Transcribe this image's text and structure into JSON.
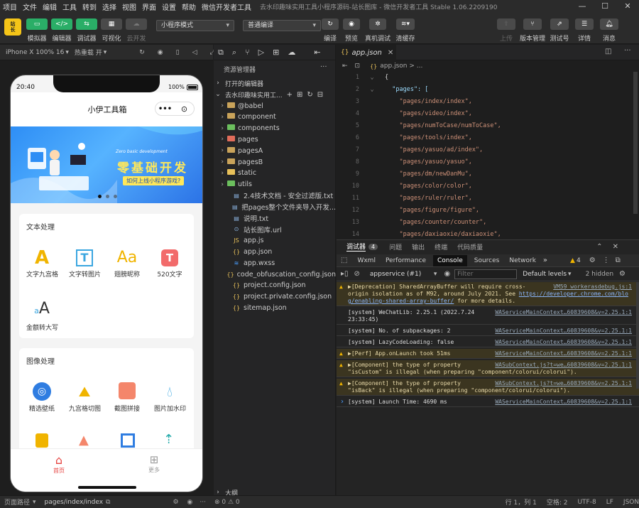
{
  "menubar": {
    "items": [
      "项目",
      "文件",
      "编辑",
      "工具",
      "转到",
      "选择",
      "视图",
      "界面",
      "设置",
      "帮助",
      "微信开发者工具"
    ],
    "title": "去水印趣味实用工具小程序源码-站长图库 - 微信开发者工具 Stable 1.06.2209190"
  },
  "toolbar": {
    "left_buttons": [
      "模拟器",
      "编辑器",
      "调试器",
      "可视化",
      "云开发"
    ],
    "mode_select": "小程序模式",
    "compile_select": "普通编译",
    "mid_buttons": [
      "编译",
      "预览",
      "真机调试",
      "清缓存"
    ],
    "right_buttons": [
      "上传",
      "版本管理",
      "测试号",
      "详情",
      "消息"
    ]
  },
  "simbar": {
    "device": "iPhone X 100% 16",
    "hotreload": "热重载 开"
  },
  "phone": {
    "time": "20:40",
    "battery": "100%",
    "nav_title": "小伊工具箱",
    "banner_small": "Zero basic development",
    "banner_title": "零基础开发",
    "banner_sub": "如何上线小程序游戏?",
    "section1": {
      "title": "文本处理",
      "items": [
        {
          "label": "文字九宫格",
          "icon": "letter-a-icon"
        },
        {
          "label": "文字转图片",
          "icon": "text-image-icon"
        },
        {
          "label": "翅膀昵称",
          "icon": "font-aa-icon"
        },
        {
          "label": "520文字",
          "icon": "t-box-icon"
        },
        {
          "label": "金额转大写",
          "icon": "translate-icon"
        }
      ]
    },
    "section2": {
      "title": "图像处理",
      "items": [
        {
          "label": "精选壁纸",
          "icon": "wallpaper-icon"
        },
        {
          "label": "九宫格切图",
          "icon": "grid-cut-icon"
        },
        {
          "label": "截图拼接",
          "icon": "stitch-icon"
        },
        {
          "label": "图片加水印",
          "icon": "watermark-icon"
        }
      ]
    },
    "tabbar": [
      {
        "label": "首页",
        "active": true
      },
      {
        "label": "更多",
        "active": false
      }
    ]
  },
  "explorer": {
    "header": "资源管理器",
    "open_editors": "打开的编辑器",
    "project": "去水印趣味实用工...",
    "items": [
      {
        "name": "@babel",
        "type": "folder"
      },
      {
        "name": "component",
        "type": "folder"
      },
      {
        "name": "components",
        "type": "folder-green"
      },
      {
        "name": "pages",
        "type": "folder-red"
      },
      {
        "name": "pagesA",
        "type": "folder"
      },
      {
        "name": "pagesB",
        "type": "folder"
      },
      {
        "name": "static",
        "type": "folder-yellow"
      },
      {
        "name": "utils",
        "type": "folder-green"
      },
      {
        "name": "2.4技术文档 - 安全过滤版.txt",
        "type": "txt"
      },
      {
        "name": "把pages整个文件夹导入开发...",
        "type": "txt"
      },
      {
        "name": "说明.txt",
        "type": "txt"
      },
      {
        "name": "站长图库.url",
        "type": "url"
      },
      {
        "name": "app.js",
        "type": "js"
      },
      {
        "name": "app.json",
        "type": "json"
      },
      {
        "name": "app.wxss",
        "type": "wxss"
      },
      {
        "name": "code_obfuscation_config.json",
        "type": "json"
      },
      {
        "name": "project.config.json",
        "type": "json"
      },
      {
        "name": "project.private.config.json",
        "type": "json"
      },
      {
        "name": "sitemap.json",
        "type": "json"
      }
    ],
    "outline": "大纲"
  },
  "editor": {
    "tab": "app.json",
    "breadcrumb": "app.json > ...",
    "lines": [
      {
        "n": "1",
        "code": "{"
      },
      {
        "n": "2",
        "code": "  \"pages\": ["
      },
      {
        "n": "3",
        "code": "    \"pages/index/index\","
      },
      {
        "n": "4",
        "code": "    \"pages/video/index\","
      },
      {
        "n": "5",
        "code": "    \"pages/numToCase/numToCase\","
      },
      {
        "n": "6",
        "code": "    \"pages/tools/index\","
      },
      {
        "n": "7",
        "code": "    \"pages/yasuo/ad/index\","
      },
      {
        "n": "8",
        "code": "    \"pages/yasuo/yasuo\","
      },
      {
        "n": "9",
        "code": "    \"pages/dm/newDanMu\","
      },
      {
        "n": "10",
        "code": "    \"pages/color/color\","
      },
      {
        "n": "11",
        "code": "    \"pages/ruler/ruler\","
      },
      {
        "n": "12",
        "code": "    \"pages/figure/figure\","
      },
      {
        "n": "13",
        "code": "    \"pages/counter/counter\","
      },
      {
        "n": "14",
        "code": "    \"pages/daxiaoxie/daxiaoxie\","
      }
    ]
  },
  "console": {
    "top_tabs": [
      "调试器",
      "问题",
      "输出",
      "终端",
      "代码质量"
    ],
    "debug_badge": "4",
    "devtabs": [
      "Wxml",
      "Performance",
      "Console",
      "Sources",
      "Network"
    ],
    "warn_count": "4",
    "context": "appservice (#1)",
    "filter_placeholder": "Filter",
    "levels": "Default levels",
    "hidden": "2 hidden",
    "messages": [
      {
        "type": "warn",
        "text1": "▶[Deprecation] SharedArrayBuffer will require cross-",
        "text2": "origin isolation as of M92, around July 2021. See ",
        "link": "https://developer.chrome.com/blo",
        "text3": "g/enabling-shared-array-buffer/",
        "text4": " for more details.",
        "src": "VM59 workerasdebug.js:1"
      },
      {
        "type": "log",
        "text1": "[system] WeChatLib: 2.25.1 (2022.7.24",
        "text2": "23:33:45)",
        "src": "WAServiceMainContext…60839608&v=2.25.1:1"
      },
      {
        "type": "log",
        "text1": "[system] No. of subpackages: 2",
        "src": "WAServiceMainContext…60839608&v=2.25.1:1"
      },
      {
        "type": "log",
        "text1": "[system] LazyCodeLoading: false",
        "src": "WAServiceMainContext…60839608&v=2.25.1:1"
      },
      {
        "type": "warn",
        "text1": "▶[Perf] App.onLaunch took 51ms",
        "src": "WAServiceMainContext…60839608&v=2.25.1:1"
      },
      {
        "type": "warn",
        "text1": "▶[Component] the type of property",
        "text2": "\"isCustom\" is illegal (when preparing \"component/colorui/colorui\").",
        "src": "WASubContext.js?t=we…60839608&v=2.25.1:1"
      },
      {
        "type": "warn",
        "text1": "▶[Component] the type of property",
        "text2": "\"isBack\" is illegal (when preparing \"component/colorui/colorui\").",
        "src": "WASubContext.js?t=we…60839608&v=2.25.1:1"
      },
      {
        "type": "log",
        "text1": "[system] Launch Time: 4690 ms",
        "src": "WAServiceMainContext…60839608&v=2.25.1:1"
      }
    ]
  },
  "statusbar": {
    "path_label": "页面路径",
    "path": "pages/index/index",
    "errors": "⊗ 0 ⚠ 0",
    "cursor": "行 1，列 1",
    "spaces": "空格: 2",
    "encoding": "UTF-8",
    "eol": "LF",
    "lang": "JSON"
  },
  "colors": {
    "accent_green": "#2aae67",
    "warn_bg": "#3b3520",
    "active_tab": "#07c160"
  }
}
